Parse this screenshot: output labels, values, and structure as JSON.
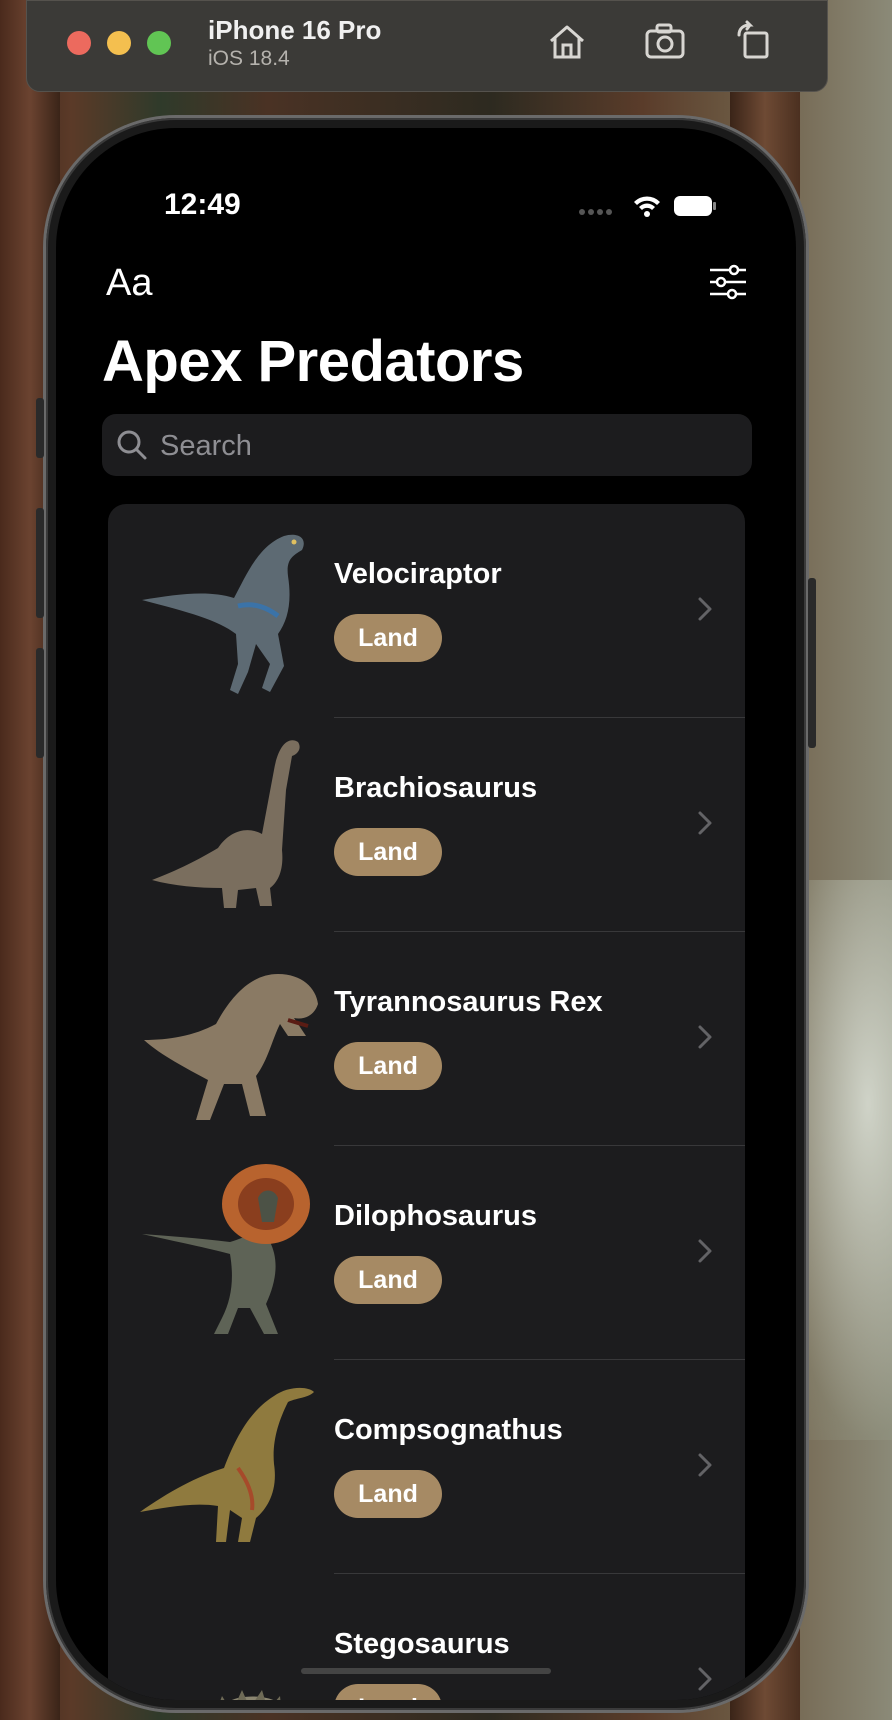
{
  "simulator": {
    "device_name": "iPhone 16 Pro",
    "os_version": "iOS 18.4",
    "icons": [
      "home-icon",
      "screenshot-icon",
      "rotate-icon"
    ]
  },
  "status_bar": {
    "time": "12:49",
    "icons": [
      "signal-icon",
      "wifi-icon",
      "battery-icon"
    ]
  },
  "nav": {
    "font_toggle_label": "Aa",
    "filter_icon": "sliders-icon"
  },
  "title": "Apex Predators",
  "search": {
    "placeholder": "Search",
    "value": ""
  },
  "colors": {
    "badge": "#a68a64",
    "row_bg": "#1c1c1e",
    "screen_bg": "#000000"
  },
  "predators": [
    {
      "name": "Velociraptor",
      "type": "Land"
    },
    {
      "name": "Brachiosaurus",
      "type": "Land"
    },
    {
      "name": "Tyrannosaurus Rex",
      "type": "Land"
    },
    {
      "name": "Dilophosaurus",
      "type": "Land"
    },
    {
      "name": "Compsognathus",
      "type": "Land"
    },
    {
      "name": "Stegosaurus",
      "type": "Land"
    }
  ]
}
